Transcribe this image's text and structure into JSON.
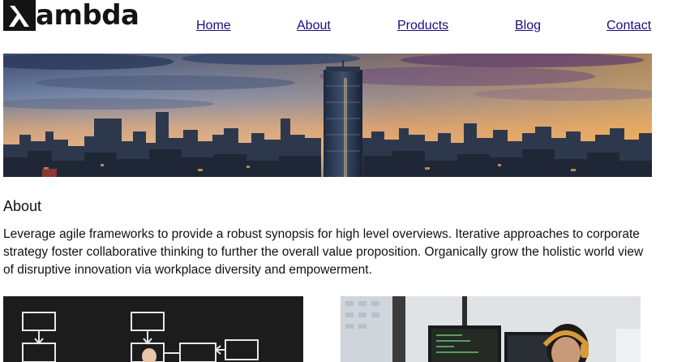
{
  "brand": {
    "logo_mark": "λ",
    "logo_text": "ambda"
  },
  "nav": {
    "items": [
      {
        "label": "Home"
      },
      {
        "label": "About"
      },
      {
        "label": "Products"
      },
      {
        "label": "Blog"
      },
      {
        "label": "Contact"
      }
    ]
  },
  "hero": {
    "image": "city-skyline-sunset"
  },
  "about": {
    "heading": "About",
    "body": "Leverage agile frameworks to provide a robust synopsis for high level overviews. Iterative approaches to corporate strategy foster collaborative thinking to further the overall value proposition. Organically grow the holistic world view of disruptive innovation via workplace diversity and empowerment."
  },
  "gallery": {
    "images": [
      {
        "name": "flowchart-chalkboard"
      },
      {
        "name": "developer-at-monitors"
      }
    ]
  },
  "colors": {
    "link": "#1a0d80",
    "text": "#111111",
    "logo": "#141414"
  }
}
